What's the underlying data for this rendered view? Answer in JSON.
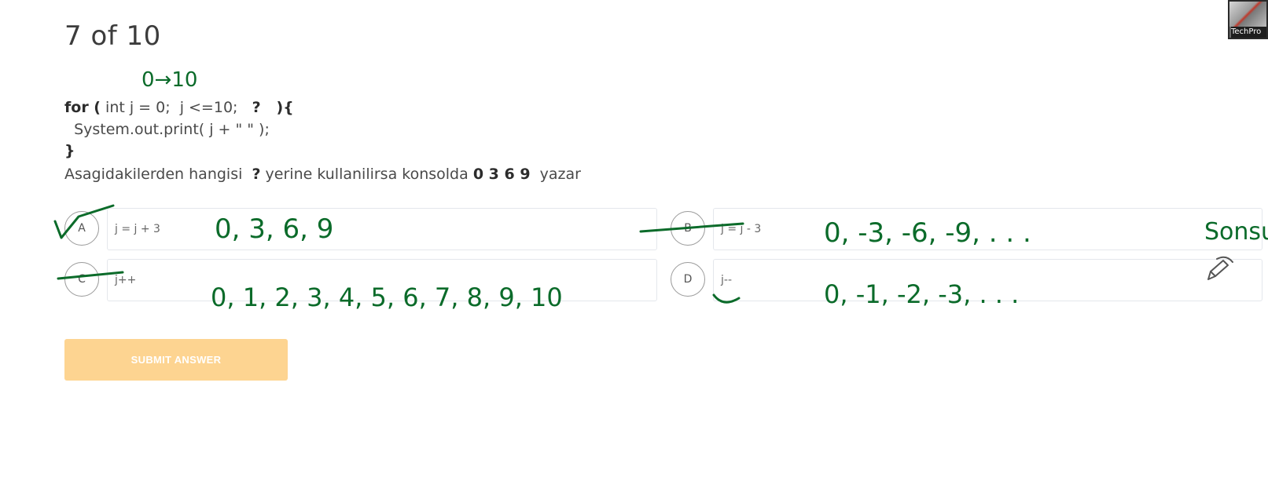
{
  "quiz": {
    "progress": "7 of 10",
    "code": {
      "line1_keyword": "for (",
      "line1_rest": " int j = 0;  j <=10;   ",
      "line1_placeholder": "?",
      "line1_end": "   ){",
      "line2": "  System.out.print( j + \" \" );",
      "line3": "}"
    },
    "question": {
      "prefix": "Asagidakilerden hangisi  ",
      "placeholder": "?",
      "middle": " yerine kullanilirsa konsolda ",
      "sequence": "0 3 6 9",
      "suffix": "  yazar"
    },
    "options": [
      {
        "letter": "A",
        "text": "j = j + 3"
      },
      {
        "letter": "B",
        "text": "j = j - 3"
      },
      {
        "letter": "C",
        "text": "j++"
      },
      {
        "letter": "D",
        "text": "j--"
      }
    ],
    "submit_label": "SUBMIT ANSWER"
  },
  "video_thumbnail": {
    "label": "TechPro"
  },
  "annotations": {
    "ink_color": "#0b6b2a",
    "range_note": "0→10",
    "option_a_note": "0, 3, 6, 9",
    "option_b_note": "0, -3, -6, -9, . . .",
    "option_b_side_note": "Sonsu",
    "option_c_note": "0, 1, 2, 3, 4, 5, 6, 7, 8, 9, 10",
    "option_d_note": "0, -1, -2, -3, . . ."
  }
}
